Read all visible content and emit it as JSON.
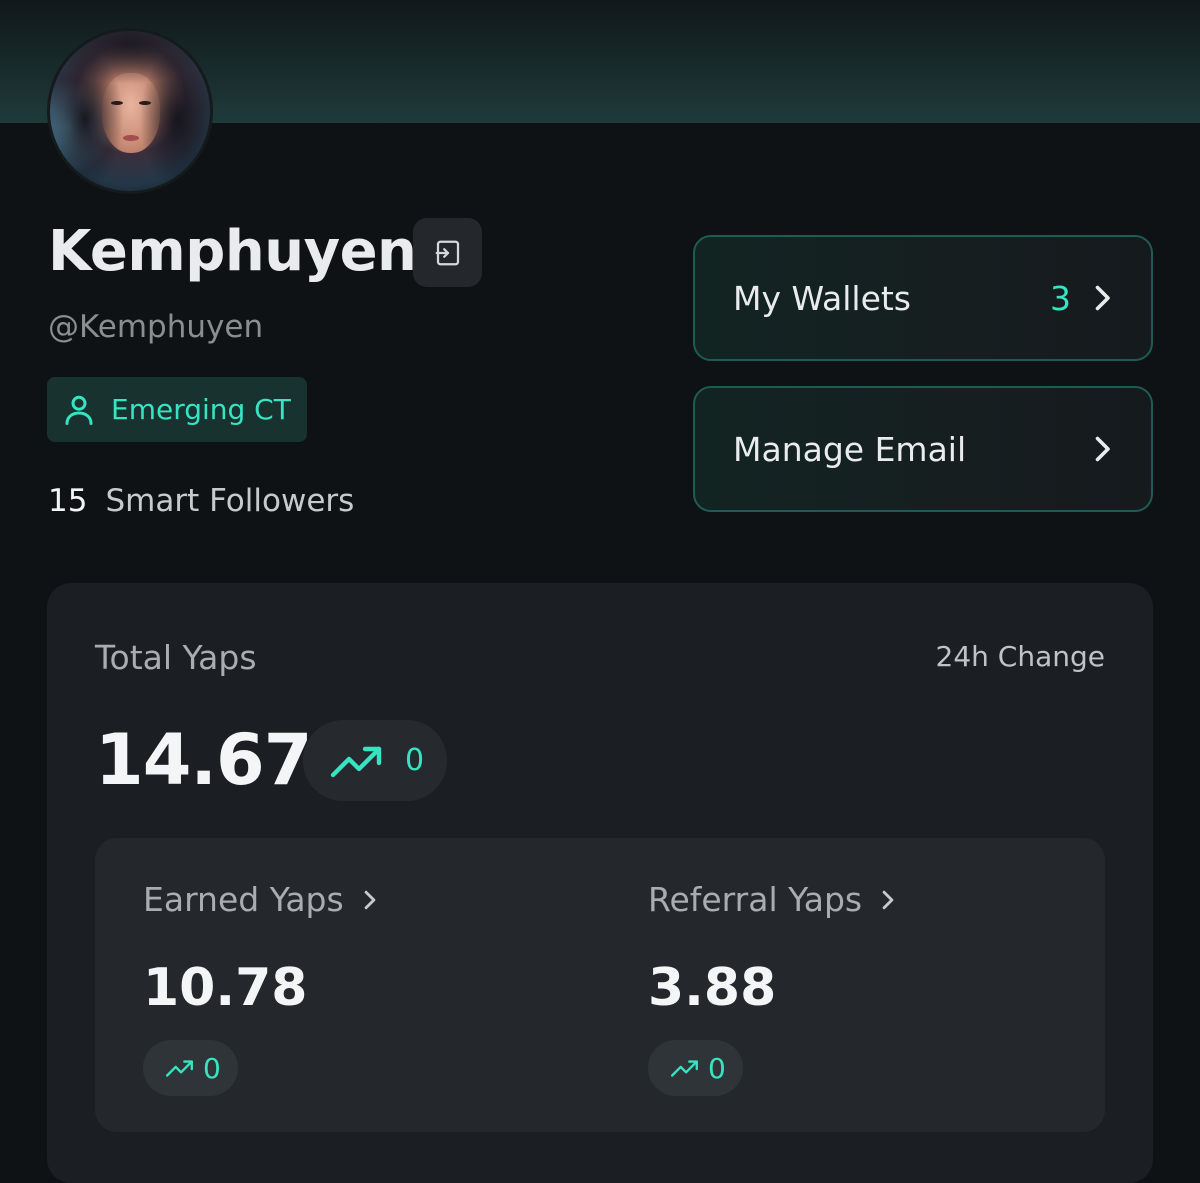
{
  "profile": {
    "display_name": "Kemphuyen",
    "handle": "@Kemphuyen",
    "badge_label": "Emerging CT",
    "smart_followers_count": "15",
    "smart_followers_label": "Smart Followers"
  },
  "actions": {
    "wallets_label": "My Wallets",
    "wallets_count": "3",
    "email_label": "Manage Email"
  },
  "yaps": {
    "total_label": "Total Yaps",
    "change_label": "24h Change",
    "total_value": "14.67",
    "total_change": "0",
    "earned_label": "Earned Yaps",
    "earned_value": "10.78",
    "earned_change": "0",
    "referral_label": "Referral Yaps",
    "referral_value": "3.88",
    "referral_change": "0"
  },
  "colors": {
    "accent": "#37e3c0",
    "background": "#0f1215",
    "card": "#1b1f23",
    "subcard": "#24282c"
  },
  "icons": {
    "logout": "logout-icon",
    "badge": "user-icon",
    "chevron": "chevron-right-icon",
    "trend": "trending-up-icon"
  }
}
